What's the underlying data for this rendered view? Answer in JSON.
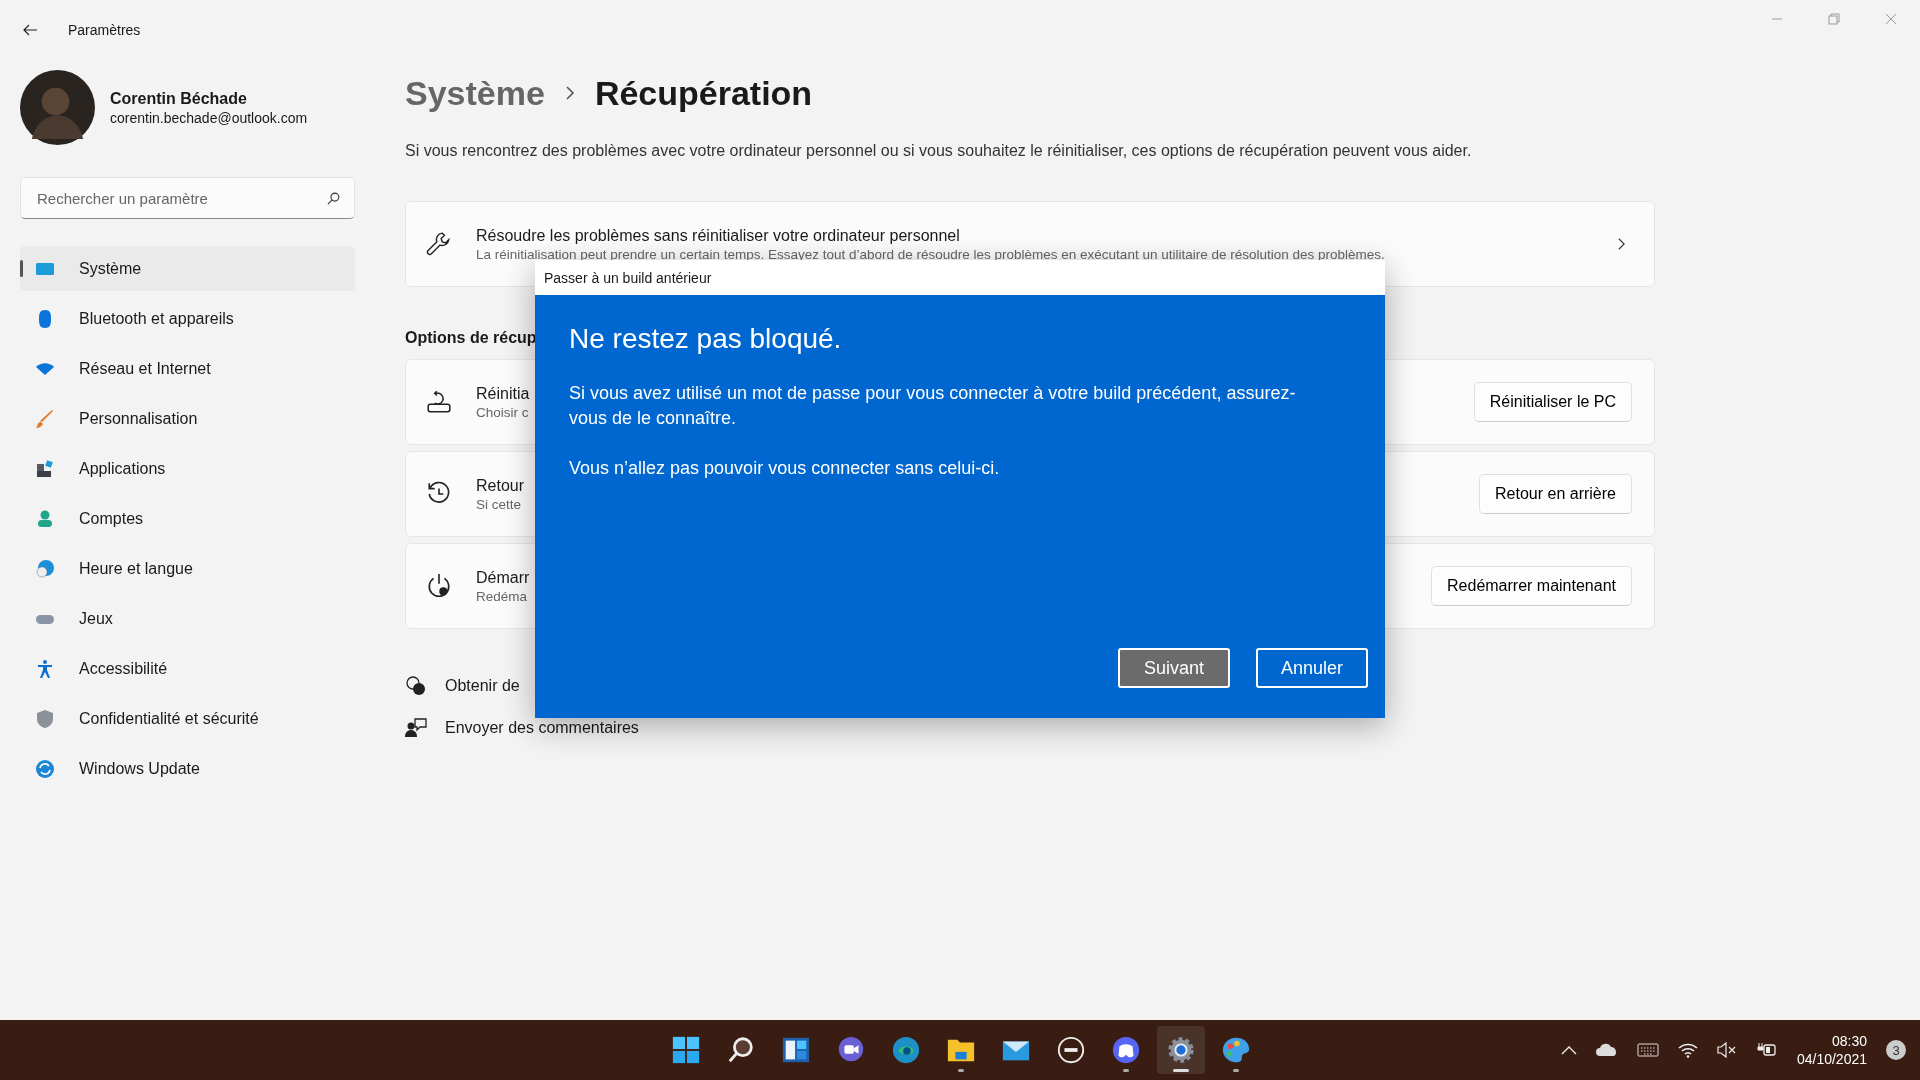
{
  "window": {
    "title": "Paramètres"
  },
  "user": {
    "name": "Corentin Béchade",
    "email": "corentin.bechade@outlook.com"
  },
  "search": {
    "placeholder": "Rechercher un paramètre"
  },
  "sidebar": {
    "items": [
      {
        "label": "Système",
        "selected": true
      },
      {
        "label": "Bluetooth et appareils",
        "selected": false
      },
      {
        "label": "Réseau et Internet",
        "selected": false
      },
      {
        "label": "Personnalisation",
        "selected": false
      },
      {
        "label": "Applications",
        "selected": false
      },
      {
        "label": "Comptes",
        "selected": false
      },
      {
        "label": "Heure et langue",
        "selected": false
      },
      {
        "label": "Jeux",
        "selected": false
      },
      {
        "label": "Accessibilité",
        "selected": false
      },
      {
        "label": "Confidentialité et sécurité",
        "selected": false
      },
      {
        "label": "Windows Update",
        "selected": false
      }
    ]
  },
  "breadcrumb": {
    "parent": "Système",
    "current": "Récupération"
  },
  "description": "Si vous rencontrez des problèmes avec votre ordinateur personnel ou si vous souhaitez le réinitialiser, ces options de récupération peuvent vous aider.",
  "troubleshoot_card": {
    "title": "Résoudre les problèmes sans réinitialiser votre ordinateur personnel",
    "subtitle": "La réinitialisation peut prendre un certain temps. Essayez tout d’abord de résoudre les problèmes en exécutant un utilitaire de résolution des problèmes."
  },
  "section_title": "Options de récup",
  "options": [
    {
      "title": "Réinitia",
      "subtitle": "Choisir c",
      "button": "Réinitialiser le PC"
    },
    {
      "title": "Retour",
      "subtitle": "Si cette",
      "button": "Retour en arrière"
    },
    {
      "title": "Démarr",
      "subtitle": "Redéma",
      "button": "Redémarrer maintenant"
    }
  ],
  "links": [
    "Obtenir de",
    "Envoyer des commentaires"
  ],
  "dialog": {
    "title": "Passer à un build antérieur",
    "heading": "Ne restez pas bloqué.",
    "paragraphs": [
      "Si vous avez utilisé un mot de passe pour vous connecter à votre build précédent, assurez-vous de le connaître.",
      "Vous n’allez pas pouvoir vous connecter sans celui-ci."
    ],
    "buttons": [
      {
        "label": "Suivant",
        "kind": "primary"
      },
      {
        "label": "Annuler",
        "kind": "secondary"
      }
    ]
  },
  "taskbar": {
    "apps": [
      {
        "running": false,
        "active": false
      },
      {
        "running": false,
        "active": false
      },
      {
        "running": false,
        "active": false
      },
      {
        "running": false,
        "active": false
      },
      {
        "running": false,
        "active": false
      },
      {
        "running": true,
        "active": false
      },
      {
        "running": false,
        "active": false
      },
      {
        "running": false,
        "active": false
      },
      {
        "running": true,
        "active": false
      },
      {
        "running": true,
        "active": true
      },
      {
        "running": true,
        "active": false
      }
    ]
  },
  "tray": {
    "time": "08:30",
    "date": "04/10/2021",
    "notifications": "3"
  }
}
